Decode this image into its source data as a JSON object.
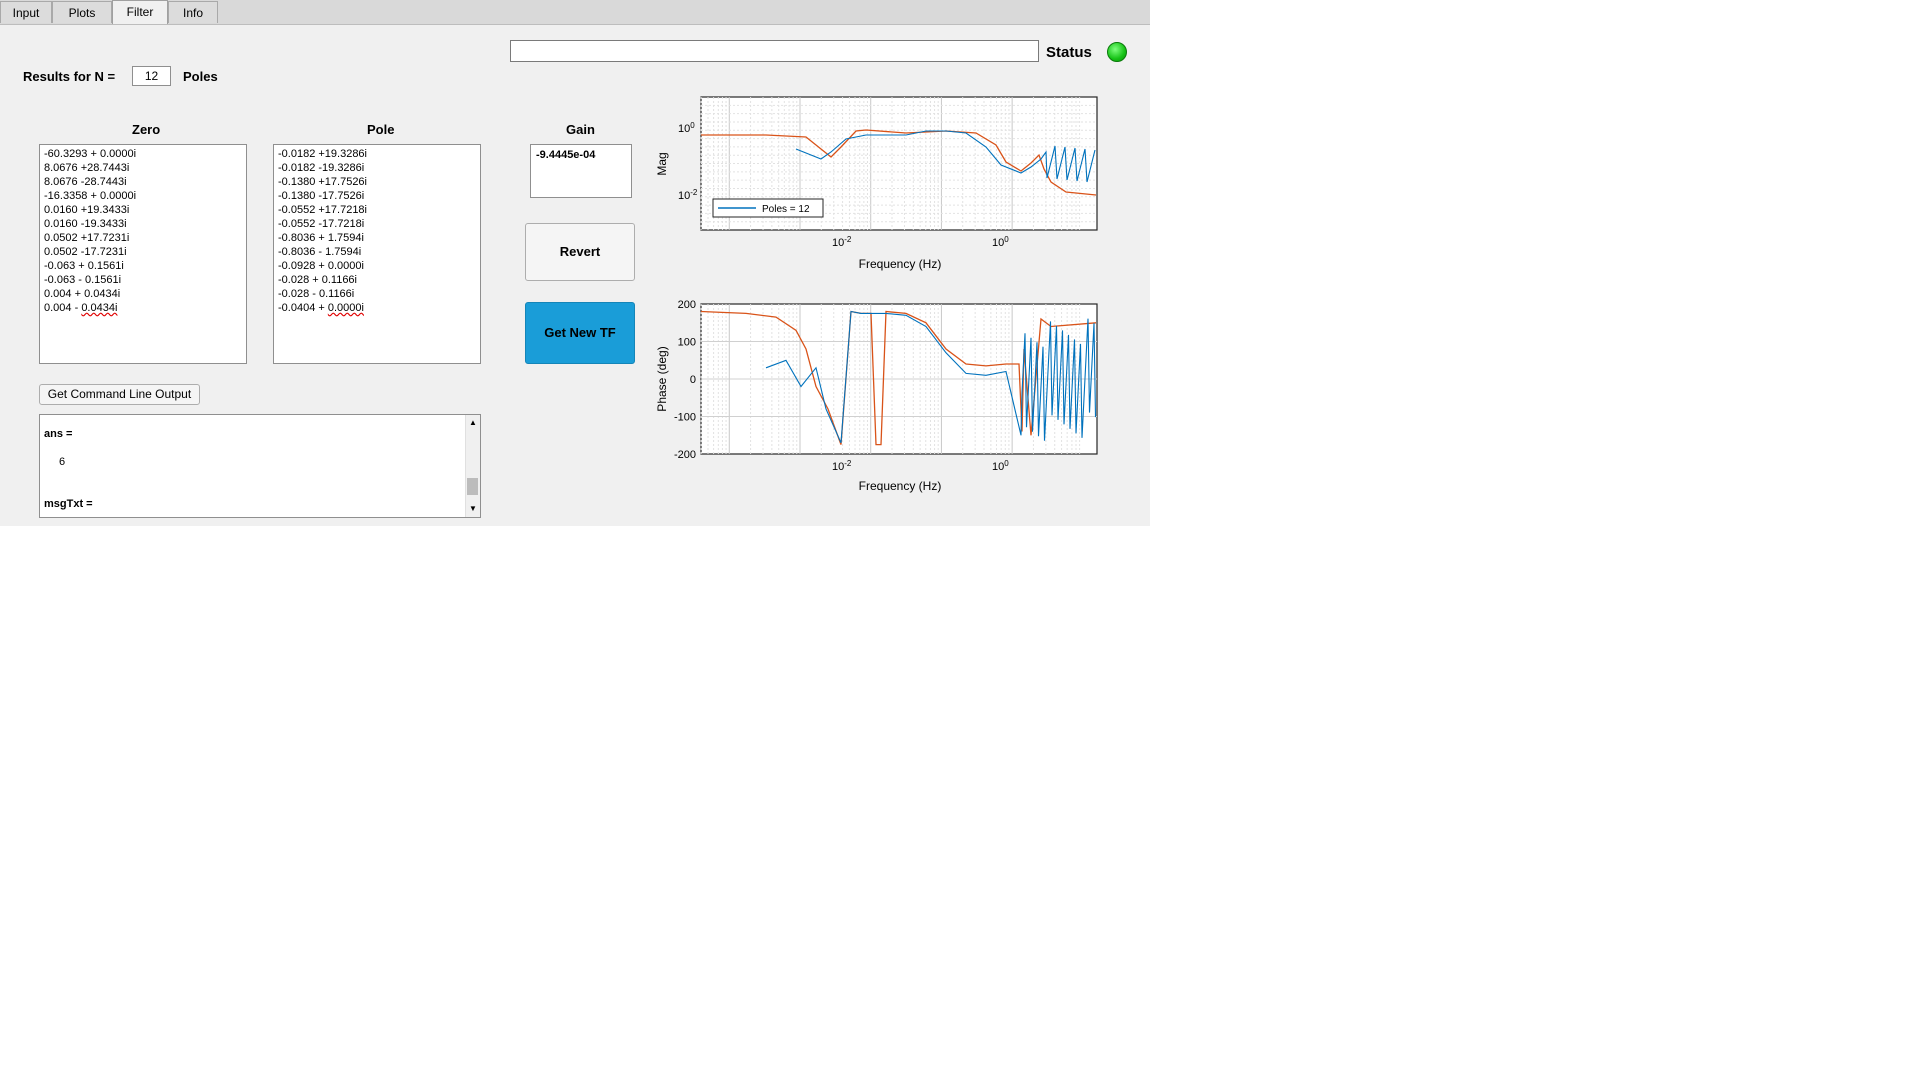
{
  "tabs": [
    {
      "label": "Input"
    },
    {
      "label": "Plots"
    },
    {
      "label": "Filter"
    },
    {
      "label": "Info"
    }
  ],
  "status": {
    "label": "Status",
    "value": "",
    "color": "#16c216"
  },
  "results": {
    "prefix": "Results for N =",
    "n": "12",
    "suffix": "Poles"
  },
  "zero": {
    "header": "Zero",
    "items": [
      "-60.3293 + 0.0000i",
      "8.0676 +28.7443i",
      "8.0676 -28.7443i",
      "-16.3358 + 0.0000i",
      "0.0160 +19.3433i",
      "0.0160 -19.3433i",
      "0.0502 +17.7231i",
      "0.0502 -17.7231i",
      "-0.063 + 0.1561i",
      "-0.063 - 0.1561i",
      "0.004 + 0.0434i",
      "0.004 - 0.0434i"
    ]
  },
  "pole": {
    "header": "Pole",
    "items": [
      "-0.0182 +19.3286i",
      "-0.0182 -19.3286i",
      "-0.1380 +17.7526i",
      "-0.1380 -17.7526i",
      "-0.0552 +17.7218i",
      "-0.0552 -17.7218i",
      "-0.8036 + 1.7594i",
      "-0.8036 - 1.7594i",
      "-0.0928 + 0.0000i",
      "-0.028 + 0.1166i",
      "-0.028 - 0.1166i",
      "-0.0404 + 0.0000i"
    ]
  },
  "gain": {
    "header": "Gain",
    "value": "-9.4445e-04"
  },
  "buttons": {
    "revert": "Revert",
    "get_new_tf": "Get New TF",
    "cmd_output": "Get Command Line Output"
  },
  "console": {
    "line1": "ans =",
    "line2": "6",
    "line3": "msgTxt ="
  },
  "mag_plot": {
    "ylabel": "Mag",
    "xlabel": "Frequency (Hz)",
    "legend": "Poles = 12",
    "yticks": [
      "10^0",
      "10^-2"
    ],
    "xticks": [
      "10^-2",
      "10^0"
    ]
  },
  "phase_plot": {
    "ylabel": "Phase (deg)",
    "xlabel": "Frequency (Hz)",
    "yticks": [
      "200",
      "100",
      "0",
      "-100",
      "-200"
    ],
    "xticks": [
      "10^-2",
      "10^0"
    ]
  },
  "colors": {
    "measured": "#0072bd",
    "fit": "#d95319",
    "accent_button": "#1a9dd8"
  }
}
